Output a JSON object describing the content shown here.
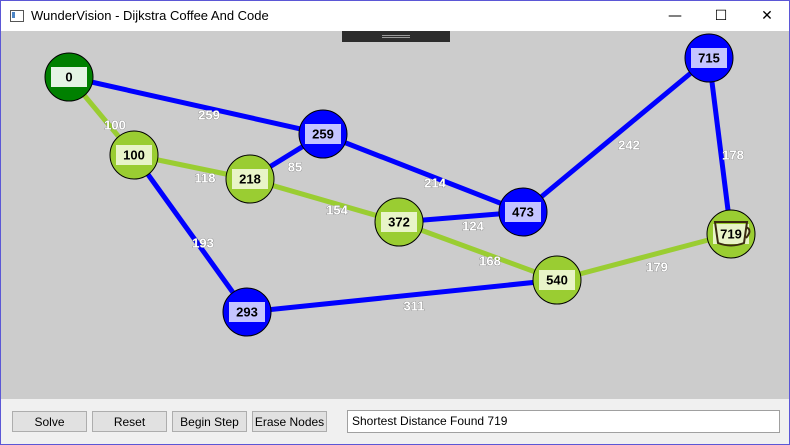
{
  "window": {
    "title": "WunderVision - Dijkstra Coffee And Code",
    "icons": {
      "app": "window-app-icon",
      "minimize": "minimize-icon",
      "maximize": "maximize-icon",
      "close": "close-icon"
    },
    "controls": {
      "minimize": "—",
      "maximize": "☐",
      "close": "✕"
    }
  },
  "colors": {
    "canvas_bg": "#cccccc",
    "path_edge": "#9acd32",
    "other_edge": "#0000ff",
    "start_node": "#008000",
    "path_node": "#9acd32",
    "other_node": "#0000ff",
    "path_label_bg": "#e8f4c8",
    "other_label_bg": "#c4c4ff",
    "start_label_bg": "#e4f4e4"
  },
  "graph": {
    "nodes": [
      {
        "id": "n0",
        "label": "0",
        "state": "start"
      },
      {
        "id": "n100",
        "label": "100",
        "state": "path"
      },
      {
        "id": "n218",
        "label": "218",
        "state": "path"
      },
      {
        "id": "n259",
        "label": "259",
        "state": "other"
      },
      {
        "id": "n293",
        "label": "293",
        "state": "other"
      },
      {
        "id": "n372",
        "label": "372",
        "state": "path"
      },
      {
        "id": "n473",
        "label": "473",
        "state": "other"
      },
      {
        "id": "n540",
        "label": "540",
        "state": "path"
      },
      {
        "id": "n715",
        "label": "715",
        "state": "other"
      },
      {
        "id": "n719",
        "label": "719",
        "state": "path",
        "icon": "coffee-cup-icon"
      }
    ],
    "edges": [
      {
        "from": "n0",
        "to": "n100",
        "weight": "100",
        "on_path": true
      },
      {
        "from": "n0",
        "to": "n259",
        "weight": "259",
        "on_path": false
      },
      {
        "from": "n100",
        "to": "n218",
        "weight": "118",
        "on_path": true
      },
      {
        "from": "n100",
        "to": "n293",
        "weight": "193",
        "on_path": false
      },
      {
        "from": "n218",
        "to": "n259",
        "weight": "85",
        "on_path": false
      },
      {
        "from": "n218",
        "to": "n372",
        "weight": "154",
        "on_path": true
      },
      {
        "from": "n259",
        "to": "n473",
        "weight": "214",
        "on_path": false
      },
      {
        "from": "n372",
        "to": "n473",
        "weight": "124",
        "on_path": false
      },
      {
        "from": "n372",
        "to": "n540",
        "weight": "168",
        "on_path": true
      },
      {
        "from": "n473",
        "to": "n715",
        "weight": "242",
        "on_path": false
      },
      {
        "from": "n715",
        "to": "n719",
        "weight": "178",
        "on_path": false
      },
      {
        "from": "n540",
        "to": "n719",
        "weight": "179",
        "on_path": true
      },
      {
        "from": "n293",
        "to": "n540",
        "weight": "311",
        "on_path": false
      }
    ]
  },
  "toolbar": {
    "solve_label": "Solve",
    "reset_label": "Reset",
    "begin_step_label": "Begin Step",
    "erase_nodes_label": "Erase Nodes"
  },
  "status": {
    "text": "Shortest Distance Found 719"
  }
}
